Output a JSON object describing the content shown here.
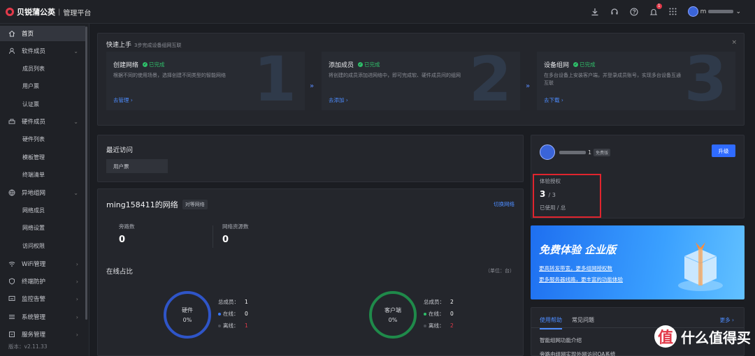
{
  "app": {
    "brand": "贝锐蒲公英",
    "separator": "|",
    "subtitle": "管理平台",
    "user_suffix": "m",
    "version": "版本：v2.11.33",
    "notification_count": "1"
  },
  "sidebar": {
    "items": [
      {
        "label": "首页",
        "icon": "home-icon"
      },
      {
        "label": "软件成员",
        "icon": "user-icon"
      },
      {
        "label": "成员列表"
      },
      {
        "label": "用户票"
      },
      {
        "label": "认证票"
      },
      {
        "label": "硬件成员",
        "icon": "hardware-icon"
      },
      {
        "label": "硬件列表"
      },
      {
        "label": "模板管理"
      },
      {
        "label": "终端清单"
      },
      {
        "label": "异地组网",
        "icon": "globe-icon"
      },
      {
        "label": "网络成员"
      },
      {
        "label": "网络设置"
      },
      {
        "label": "访问权限"
      },
      {
        "label": "WiFi管理",
        "icon": "wifi-icon"
      },
      {
        "label": "终端防护",
        "icon": "shield-icon"
      },
      {
        "label": "监控告警",
        "icon": "monitor-icon"
      },
      {
        "label": "系统管理",
        "icon": "system-icon"
      },
      {
        "label": "服务管理",
        "icon": "service-icon"
      }
    ]
  },
  "quickstart": {
    "title": "快速上手",
    "subtitle": "3步完成设备组网互联",
    "close": "×",
    "done_label": "已完成",
    "steps": [
      {
        "num": "1",
        "name": "创建网络",
        "desc": "根据不同的使用场景，选择创建不同类型的智能网络",
        "link": "去管理 ›"
      },
      {
        "num": "2",
        "name": "添加成员",
        "desc": "将创建的成员添加进网络中，即可完成软、硬件成员间的组网",
        "link": "去添加 ›"
      },
      {
        "num": "3",
        "name": "设备组网",
        "desc": "在多台设备上安装客户端，并登录成员账号，实现多台设备互通互联",
        "link": "去下载 ›"
      }
    ]
  },
  "recent": {
    "title": "最近访问",
    "chip": "用户票"
  },
  "network": {
    "name": "ming158411的网络",
    "tag": "对等网络",
    "switch": "切换网络",
    "stats": [
      {
        "label": "旁路数",
        "value": "0"
      },
      {
        "label": "网络资源数",
        "value": "0"
      }
    ],
    "online_title": "在线占比",
    "unit": "（单位：台）",
    "rings": [
      {
        "label": "硬件",
        "pct": "0%",
        "total_k": "总成员：",
        "total": "1",
        "online_k": "在线：",
        "online": "0",
        "offline_k": "离线：",
        "offline": "1",
        "color": "#2f55c8"
      },
      {
        "label": "客户端",
        "pct": "0%",
        "total_k": "总成员：",
        "total": "2",
        "online_k": "在线：",
        "online": "0",
        "offline_k": "离线：",
        "offline": "2",
        "color": "#1f8a4a"
      }
    ]
  },
  "account": {
    "name_suffix": "1",
    "free_tag": "免费版",
    "upgrade": "升级",
    "license_label": "体验授权",
    "license_used": "3",
    "license_total": "/ 3",
    "license_caption": "已使用 / 总"
  },
  "promo": {
    "title": "免费体验 企业版",
    "line1_a": "更高转发带宽，",
    "line1_b": "更多组网授权数",
    "line2_a": "更多服务器线路，",
    "line2_b": "更丰富的功能体验"
  },
  "help": {
    "tabs": [
      "使用帮助",
      "常见问题"
    ],
    "more": "更多 ›",
    "items": [
      "智能组网功能介绍",
      "旁路由组网实现外网访问OA系统"
    ]
  },
  "watermark": {
    "icon": "值",
    "text": "什么值得买"
  },
  "colors": {
    "accent": "#4d8cff",
    "success": "#2fbf6a",
    "danger": "#e23a4a",
    "highlight": "#e0242e"
  }
}
